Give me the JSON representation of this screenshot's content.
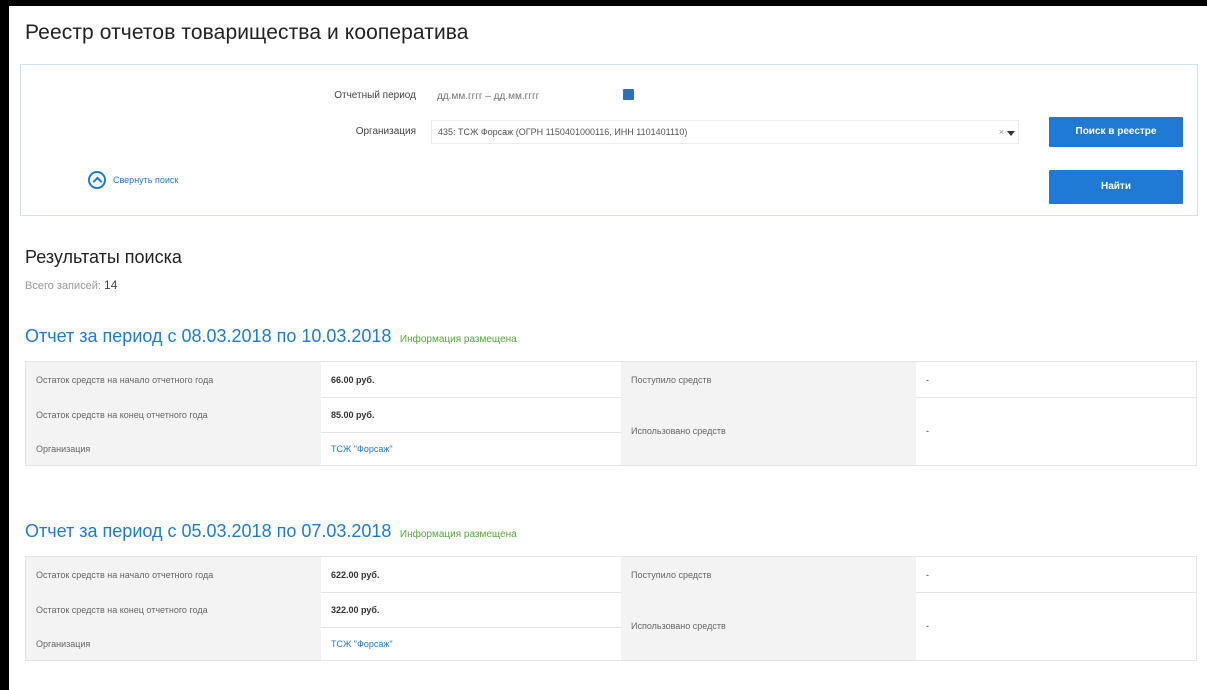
{
  "page_title": "Реестр отчетов товарищества и кооператива",
  "search": {
    "period_label": "Отчетный период",
    "period_placeholder": "дд.мм.гггг – дд.мм.гггг",
    "org_label": "Организация",
    "org_value": "435: ТСЖ Форсаж (ОГРН 1150401000116, ИНН 1101401110)",
    "clear_symbol": "×",
    "registry_button": "Поиск в реестре",
    "find_button": "Найти",
    "collapse_label": "Свернуть поиск"
  },
  "results": {
    "title": "Результаты поиска",
    "count_label": "Всего записей:",
    "count": "14"
  },
  "labels": {
    "balance_start": "Остаток средств на начало отчетного года",
    "balance_end": "Остаток средств на конец отчетного года",
    "organization": "Организация",
    "receipts": "Поступило средств",
    "usage": "Использовано средств"
  },
  "reports": [
    {
      "title": "Отчет за период с 08.03.2018 по 10.03.2018",
      "status": "Информация размещена",
      "balance_start": "66.00 руб.",
      "balance_end": "85.00 руб.",
      "organization": "ТСЖ \"Форсаж\"",
      "receipts": "-",
      "usage": "-"
    },
    {
      "title": "Отчет за период с 05.03.2018 по 07.03.2018",
      "status": "Информация размещена",
      "balance_start": "622.00 руб.",
      "balance_end": "322.00 руб.",
      "organization": "ТСЖ \"Форсаж\"",
      "receipts": "-",
      "usage": "-"
    }
  ],
  "colors": {
    "accent": "#1f7ad6",
    "status_green": "#56a83a",
    "label_bg": "#f3f3f3"
  }
}
